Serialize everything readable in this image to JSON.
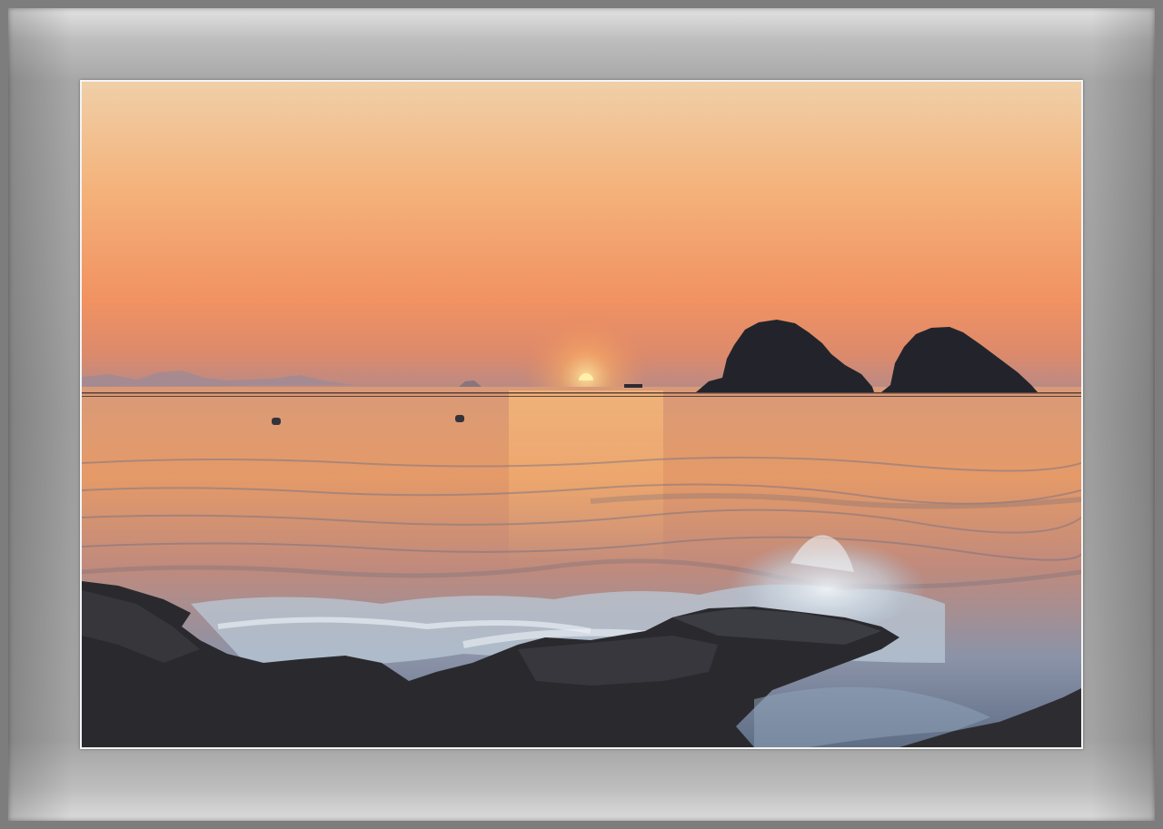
{
  "image": {
    "subject": "sunset-over-sea-with-two-islets-and-rocky-shore",
    "colors": {
      "sky_top": "#f2c9a0",
      "sky_mid": "#f3a36a",
      "sky_low": "#e9805a",
      "haze": "#b98a86",
      "sea_far": "#d88d6a",
      "sea_near": "#7a8aa0",
      "rocks": "#2b2b2e",
      "sun": "#ffb24a",
      "mat": "#a0a0a0"
    }
  }
}
